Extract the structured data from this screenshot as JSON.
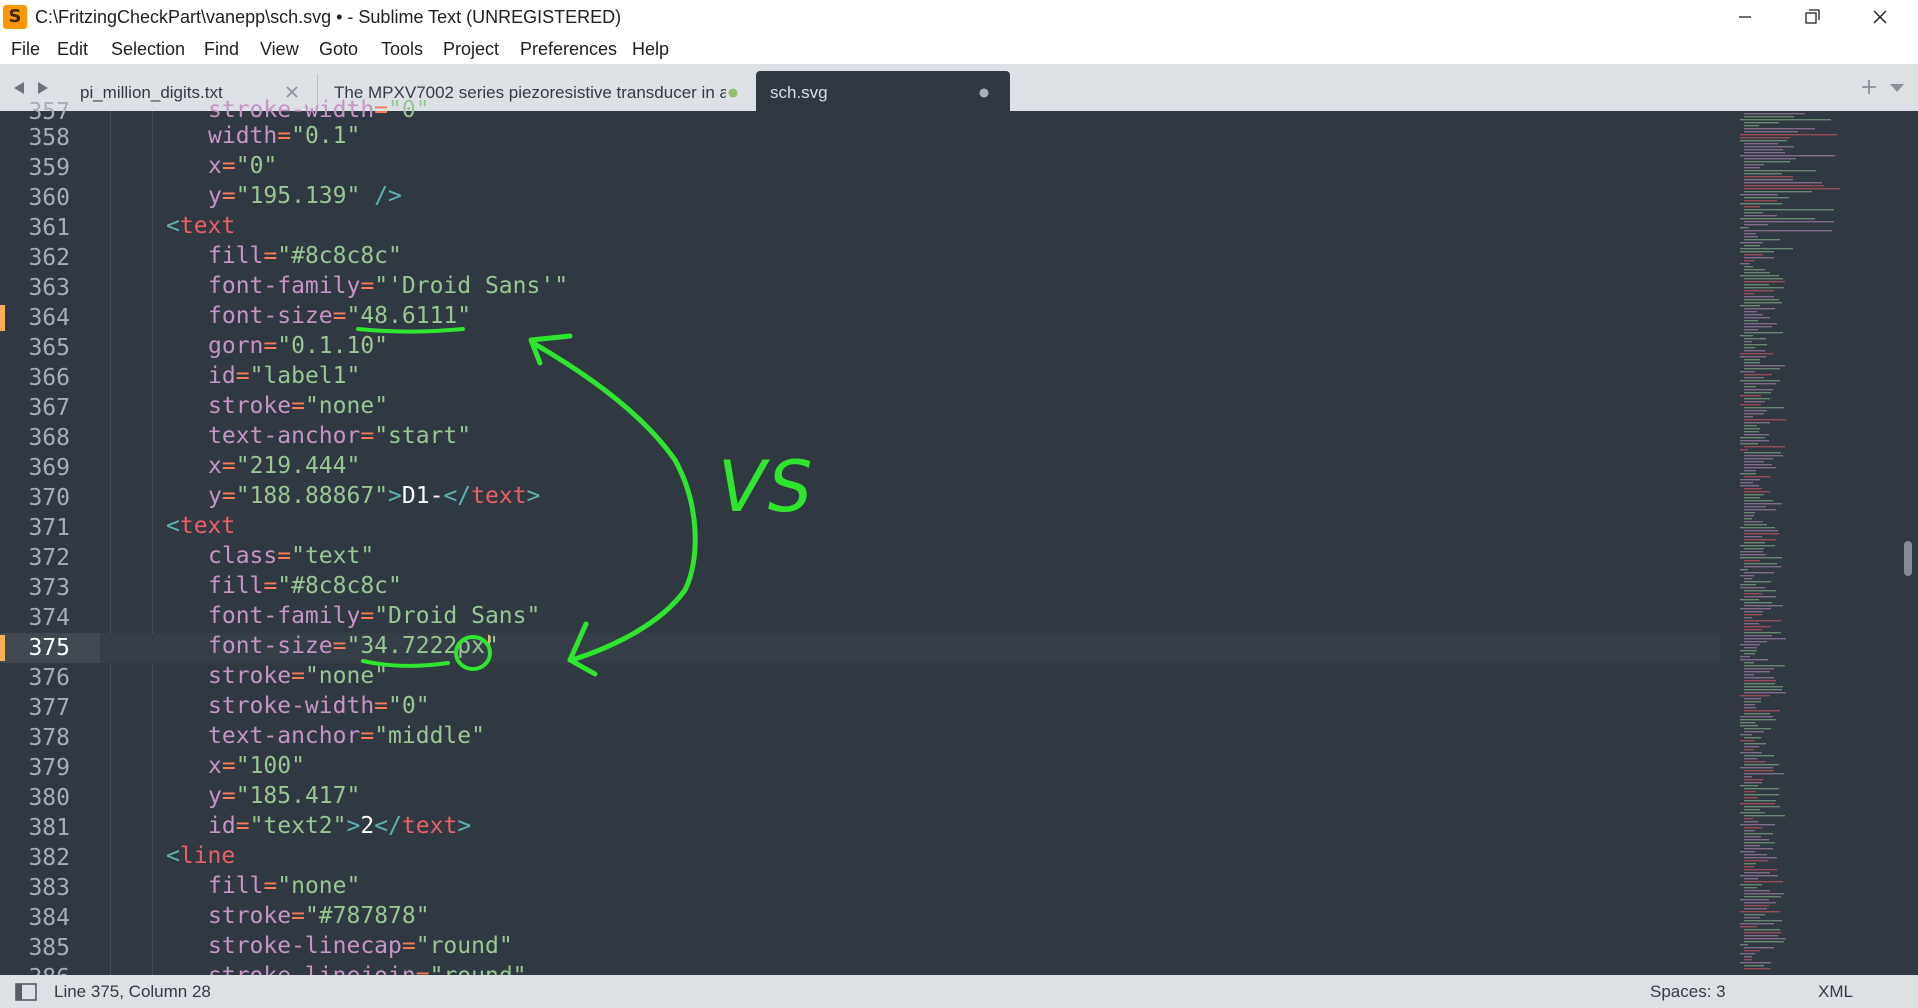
{
  "window": {
    "title": "C:\\FritzingCheckPart\\vanepp\\sch.svg • - Sublime Text (UNREGISTERED)",
    "app_icon_glyph": "S"
  },
  "menu": [
    "File",
    "Edit",
    "Selection",
    "Find",
    "View",
    "Goto",
    "Tools",
    "Project",
    "Preferences",
    "Help"
  ],
  "tabs": [
    {
      "label": "pi_million_digits.txt",
      "state": "close"
    },
    {
      "label": "The MPXV7002 series piezoresistive transducer in a",
      "state": "dirty"
    },
    {
      "label": "sch.svg",
      "state": "dirty"
    }
  ],
  "colors": {
    "background": "#303841",
    "attribute": "#c695c6",
    "string": "#99c794",
    "tag": "#ec5f67",
    "annotation": "#2ee62e",
    "dirty_marker": "#f9ae58"
  },
  "editor": {
    "partial_top_line": {
      "number": "357",
      "text": "stroke-width=\"0\""
    },
    "lines": [
      {
        "n": "358",
        "text": "width=\"0.1\""
      },
      {
        "n": "359",
        "text": "x=\"0\""
      },
      {
        "n": "360",
        "text": "y=\"195.139\" />"
      },
      {
        "n": "361",
        "text": "<text"
      },
      {
        "n": "362",
        "text": "fill=\"#8c8c8c\""
      },
      {
        "n": "363",
        "text": "font-family=\"'Droid Sans'\""
      },
      {
        "n": "364",
        "text": "font-size=\"48.6111\"",
        "modified": true
      },
      {
        "n": "365",
        "text": "gorn=\"0.1.10\""
      },
      {
        "n": "366",
        "text": "id=\"label1\""
      },
      {
        "n": "367",
        "text": "stroke=\"none\""
      },
      {
        "n": "368",
        "text": "text-anchor=\"start\""
      },
      {
        "n": "369",
        "text": "x=\"219.444\""
      },
      {
        "n": "370",
        "text": "y=\"188.88867\">D1-</text>"
      },
      {
        "n": "371",
        "text": "<text"
      },
      {
        "n": "372",
        "text": "class=\"text\""
      },
      {
        "n": "373",
        "text": "fill=\"#8c8c8c\""
      },
      {
        "n": "374",
        "text": "font-family=\"Droid Sans\""
      },
      {
        "n": "375",
        "text": "font-size=\"34.7222px\"",
        "modified": true,
        "current": true
      },
      {
        "n": "376",
        "text": "stroke=\"none\""
      },
      {
        "n": "377",
        "text": "stroke-width=\"0\""
      },
      {
        "n": "378",
        "text": "text-anchor=\"middle\""
      },
      {
        "n": "379",
        "text": "x=\"100\""
      },
      {
        "n": "380",
        "text": "y=\"185.417\""
      },
      {
        "n": "381",
        "text": "id=\"text2\">2</text>"
      },
      {
        "n": "382",
        "text": "<line"
      },
      {
        "n": "383",
        "text": "fill=\"none\""
      },
      {
        "n": "384",
        "text": "stroke=\"#787878\""
      },
      {
        "n": "385",
        "text": "stroke-linecap=\"round\""
      }
    ],
    "partial_bottom_line": {
      "number": "386",
      "text": "stroke-linejoin=\"round\""
    }
  },
  "annotation": {
    "text": "VS",
    "compare": [
      "48.6111",
      "34.7222px"
    ],
    "highlight": "px"
  },
  "status": {
    "position": "Line 375, Column 28",
    "indent": "Spaces: 3",
    "syntax": "XML"
  }
}
